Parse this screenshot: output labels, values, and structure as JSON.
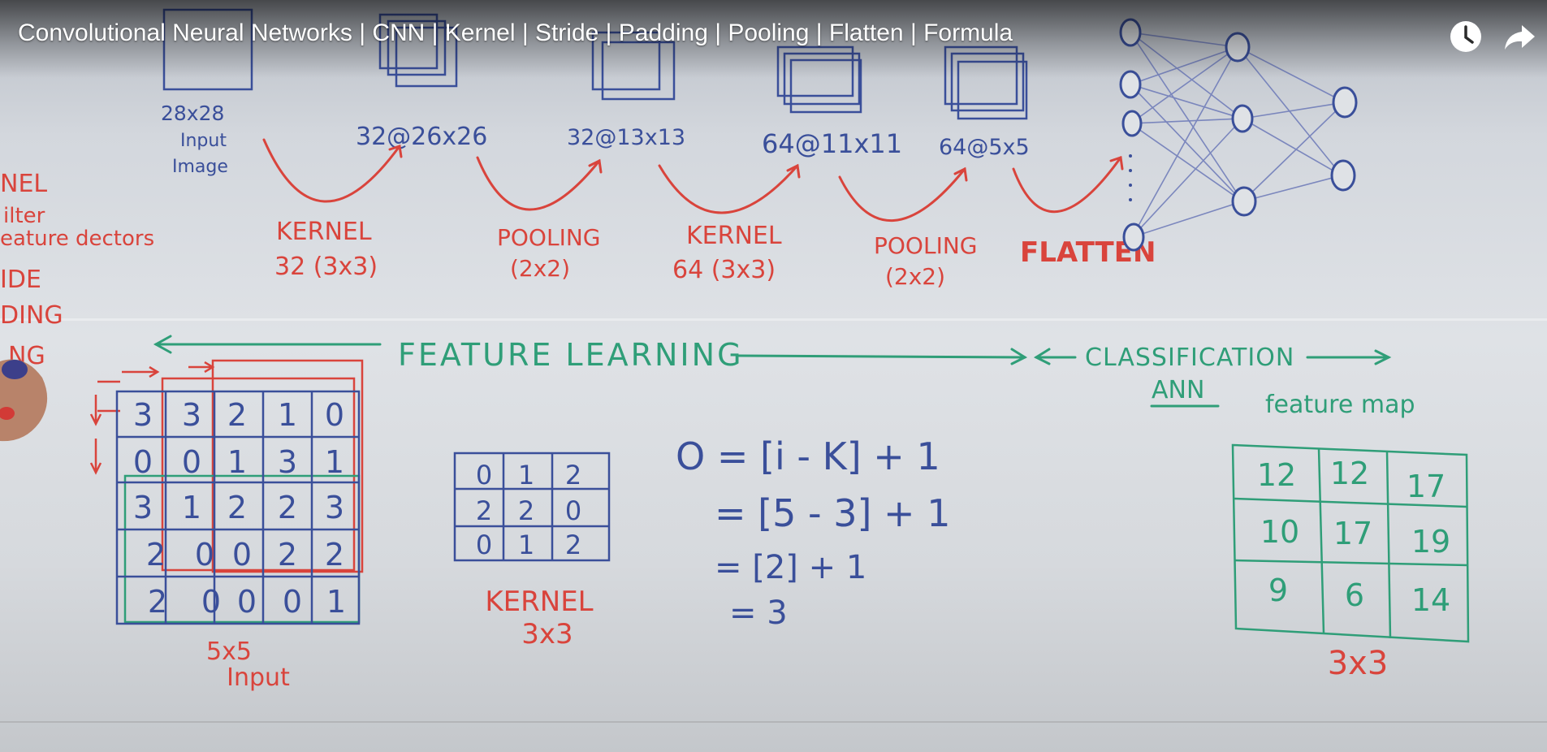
{
  "video": {
    "title": "Convolutional Neural Networks | CNN | Kernel | Stride | Padding | Pooling | Flatten | Formula",
    "icons": [
      "clock-icon",
      "share-icon"
    ]
  },
  "board": {
    "left_labels": [
      "NEL",
      "ilter",
      "eature dectors",
      "IDE",
      "DING",
      "NG"
    ],
    "stages": [
      {
        "size": "28x28",
        "caption1": "Input",
        "caption2": "Image"
      },
      {
        "size": "32@26x26"
      },
      {
        "size": "32@13x13"
      },
      {
        "size": "64@11x11"
      },
      {
        "size": "64@5x5"
      }
    ],
    "operations": [
      {
        "name": "KERNEL",
        "param": "32 (3x3)"
      },
      {
        "name": "POOLING",
        "param": "(2x2)"
      },
      {
        "name": "KERNEL",
        "param": "64 (3x3)"
      },
      {
        "name": "POOLING",
        "param": "(2x2)"
      },
      {
        "name": "FLATTEN",
        "param": ""
      }
    ],
    "section_feature": "FEATURE LEARNING",
    "section_classification": "CLASSIFICATION",
    "ann_label": "ANN",
    "feature_map_label": "feature map",
    "input_matrix": [
      [
        "3",
        "3",
        "2",
        "1",
        "0"
      ],
      [
        "0",
        "0",
        "1",
        "3",
        "1"
      ],
      [
        "3",
        "1",
        "2",
        "2",
        "3"
      ],
      [
        "2",
        "0",
        "0",
        "2",
        "2"
      ],
      [
        "2",
        "0",
        "0",
        "0",
        "1"
      ]
    ],
    "input_label1": "5x5",
    "input_label2": "Input",
    "kernel_matrix": [
      [
        "0",
        "1",
        "2"
      ],
      [
        "2",
        "2",
        "0"
      ],
      [
        "0",
        "1",
        "2"
      ]
    ],
    "kernel_label1": "KERNEL",
    "kernel_label2": "3x3",
    "formula": [
      "O = [i - K] + 1",
      "= [5 - 3] + 1",
      "= [2] + 1",
      "= 3"
    ],
    "output_matrix": [
      [
        "12",
        "12",
        "17"
      ],
      [
        "10",
        "17",
        "19"
      ],
      [
        "9",
        "6",
        "14"
      ]
    ],
    "output_label": "3x3"
  },
  "colors": {
    "marker_blue": "#3a4f9a",
    "marker_red": "#d9443c",
    "marker_green": "#2f9e78"
  }
}
